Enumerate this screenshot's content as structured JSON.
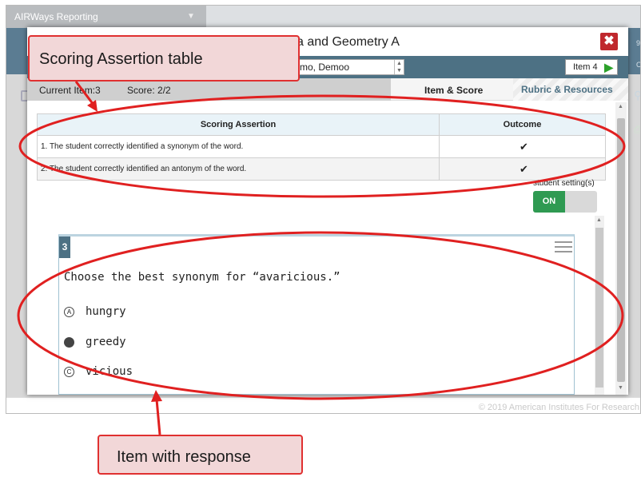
{
  "app": {
    "tab_title": "AIRWays Reporting",
    "copyright": "© 2019 American Institutes For Research",
    "right_fragment_1": "998",
    "right_fragment_2": "Ou"
  },
  "modal": {
    "title": "a and Geometry A",
    "student_name": "mo, Demoo",
    "next_item_label": "Item 4",
    "current_item": "Current Item:3",
    "score": "Score: 2/2",
    "tab_item_score": "Item & Score",
    "tab_rubric": "Rubric & Resources"
  },
  "scoring_table": {
    "headers": [
      "Scoring Assertion",
      "Outcome"
    ],
    "rows": [
      {
        "assertion": "1. The student correctly identified a synonym of the word.",
        "outcome": "✔"
      },
      {
        "assertion": "2. The student correctly identified an antonym of the word.",
        "outcome": "✔"
      }
    ]
  },
  "student_setting": {
    "label": "student setting(s)",
    "toggle_label": "ON"
  },
  "item": {
    "number": "3",
    "question": "Choose the best synonym for “avaricious.”",
    "options": [
      {
        "letter": "A",
        "text": "hungry",
        "selected": false
      },
      {
        "letter": "B",
        "text": "greedy",
        "selected": true
      },
      {
        "letter": "C",
        "text": "vicious",
        "selected": false
      }
    ]
  },
  "annotations": {
    "top_callout": "Scoring Assertion table",
    "bottom_callout": "Item with response",
    "color": "#e02020"
  }
}
